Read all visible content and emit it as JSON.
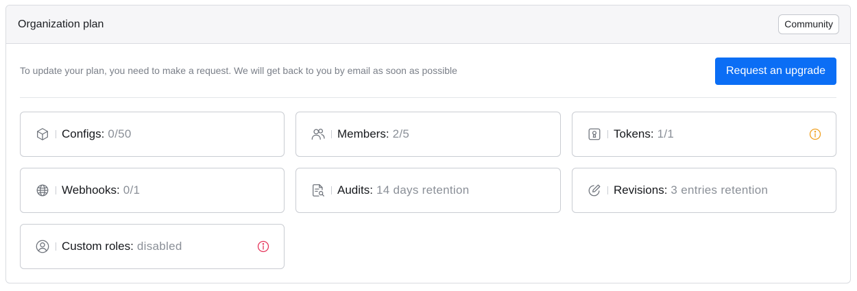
{
  "header": {
    "title": "Organization plan",
    "badge": "Community"
  },
  "request": {
    "text": "To update your plan, you need to make a request. We will get back to you by email as soon as possible",
    "button_label": "Request an upgrade"
  },
  "colors": {
    "accent": "#0b6ef5",
    "warning": "#f0a020",
    "danger": "#e5345a"
  },
  "cards": [
    {
      "icon": "cube-icon",
      "label": "Configs:",
      "value": "0/50"
    },
    {
      "icon": "users-icon",
      "label": "Members:",
      "value": "2/5"
    },
    {
      "icon": "keyhole-icon",
      "label": "Tokens:",
      "value": "1/1",
      "info": "warning-info-icon"
    },
    {
      "icon": "globe-icon",
      "label": "Webhooks:",
      "value": "0/1"
    },
    {
      "icon": "document-search-icon",
      "label": "Audits:",
      "value": "14 days retention"
    },
    {
      "icon": "edit-circle-icon",
      "label": "Revisions:",
      "value": "3 entries retention"
    },
    {
      "icon": "user-circle-icon",
      "label": "Custom roles:",
      "value": "disabled",
      "info": "danger-info-icon"
    }
  ]
}
